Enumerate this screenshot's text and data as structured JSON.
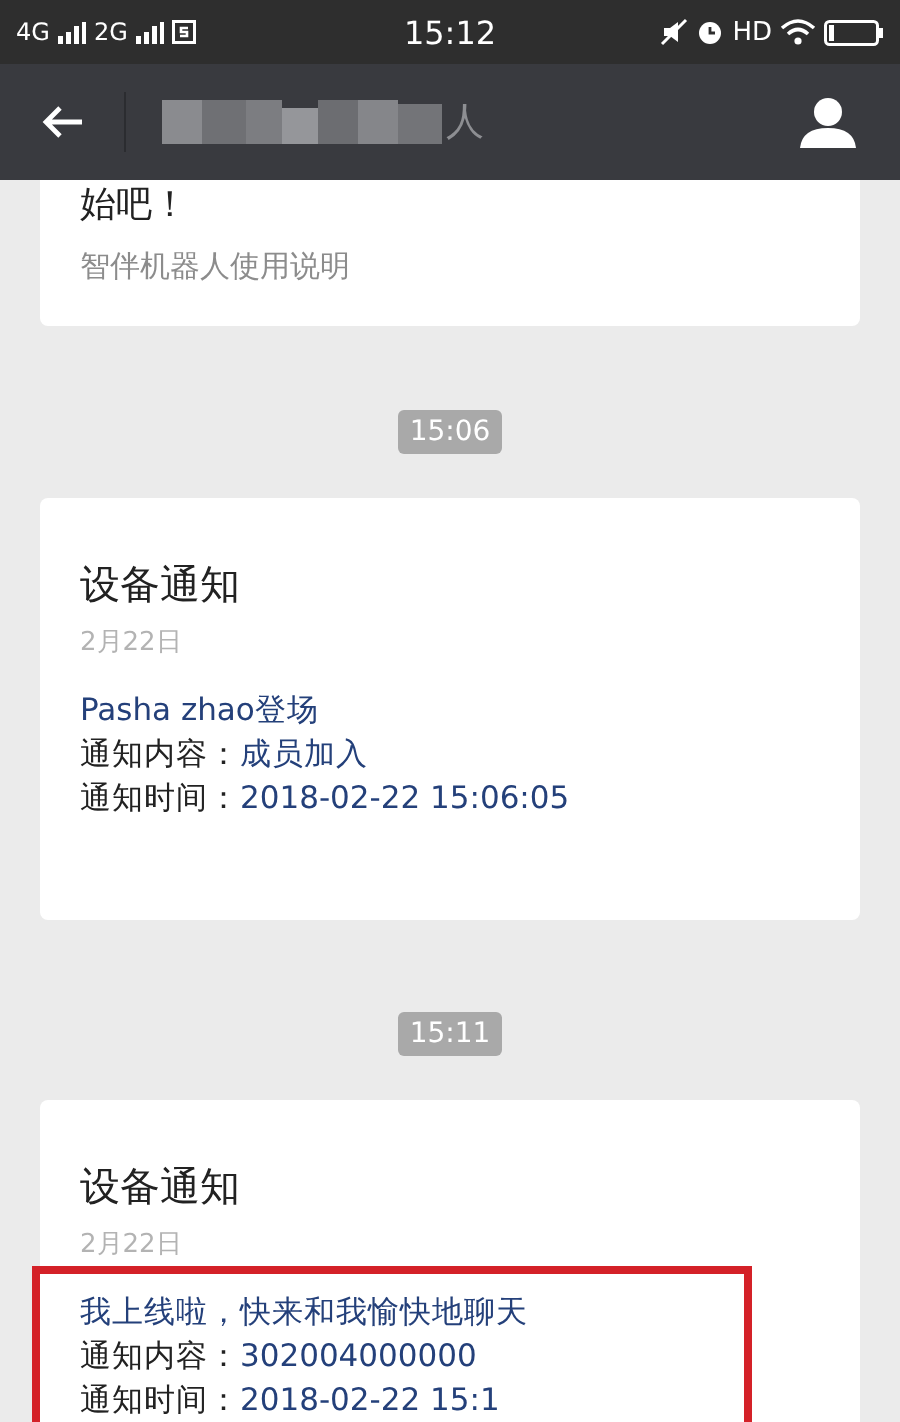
{
  "status_bar": {
    "network_1": "4G",
    "network_2": "2G",
    "time": "15:12",
    "hd": "HD"
  },
  "header": {
    "title_visible": "人"
  },
  "messages": [
    {
      "kind": "article",
      "lines": [
        "始吧！"
      ],
      "footer": "智伴机器人使用说明"
    },
    {
      "kind": "time",
      "text": "15:06"
    },
    {
      "kind": "notice",
      "title": "设备通知",
      "date": "2月22日",
      "headline": "Pasha zhao登场",
      "fields": [
        {
          "label": "通知内容：",
          "value": "成员加入"
        },
        {
          "label": "通知时间：",
          "value": "2018-02-22 15:06:05"
        }
      ],
      "highlighted": false
    },
    {
      "kind": "time",
      "text": "15:11"
    },
    {
      "kind": "notice",
      "title": "设备通知",
      "date": "2月22日",
      "headline": "我上线啦，快来和我愉快地聊天",
      "fields": [
        {
          "label": "通知内容：",
          "value": "302004000000"
        },
        {
          "label": "通知时间：",
          "value": "2018-02-22 15:1"
        }
      ],
      "highlighted": true
    }
  ]
}
